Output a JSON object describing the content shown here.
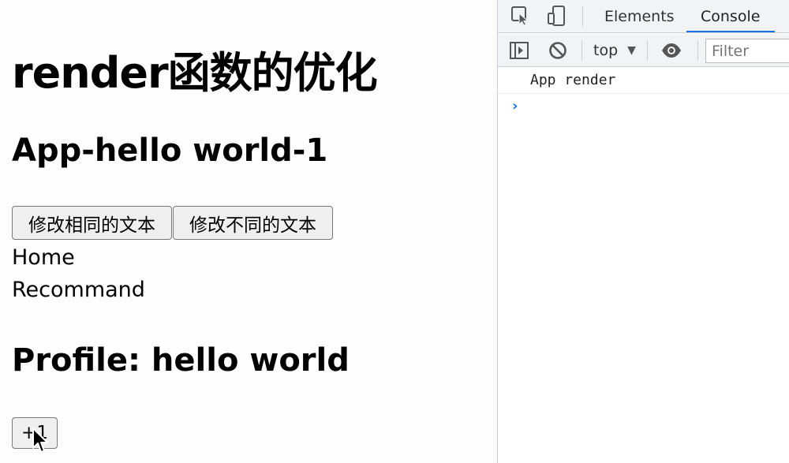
{
  "page": {
    "title": "render函数的优化",
    "app_heading": "App-hello world-1",
    "buttons": {
      "same_text": "修改相同的文本",
      "different_text": "修改不同的文本",
      "increment": "+1"
    },
    "home_text": "Home",
    "recommend_text": "Recommand",
    "profile_heading": "Profile: hello world"
  },
  "devtools": {
    "tabs": [
      "Elements",
      "Console"
    ],
    "active_tab": "Console",
    "context_label": "top",
    "filter_placeholder": "Filter",
    "console_messages": [
      "App render"
    ],
    "accent_color": "#1a73e8"
  }
}
